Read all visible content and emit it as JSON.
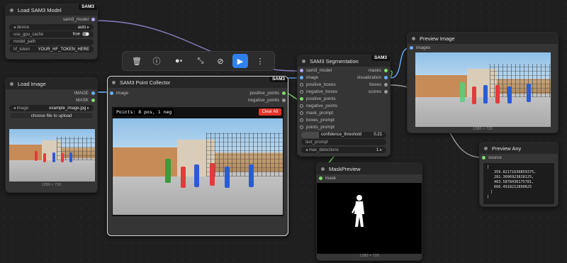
{
  "load_sam3": {
    "title": "Load SAM3 Model",
    "tag": "SAM3",
    "output": "sam3_model",
    "widgets": [
      {
        "label": "device",
        "value": "auto"
      },
      {
        "label": "use_gpu_cache",
        "value": "true"
      },
      {
        "label": "model_path",
        "value": ""
      },
      {
        "label": "hf_token",
        "value": "YOUR_HF_TOKEN_HERE"
      }
    ]
  },
  "load_image": {
    "title": "Load Image",
    "outputs": [
      "IMAGE",
      "MASK"
    ],
    "image_label": "image",
    "image_value": "example_image.jpg",
    "upload_button": "choose file to upload",
    "caption": "1280 × 720"
  },
  "point_collector": {
    "title": "SAM3 Point Collector",
    "tag": "SAM3",
    "input": "image",
    "outputs": [
      "positive_points",
      "negative_points"
    ],
    "points_status": "Points: 8 pos, 1 neg",
    "clear_button": "Clear All"
  },
  "segmentation": {
    "title": "SAM3 Segmentation",
    "tag": "SAM3",
    "inputs": [
      "sam3_model",
      "image",
      "positive_boxes",
      "negative_boxes",
      "positive_points",
      "negative_points",
      "mask_prompt",
      "boxes_prompt",
      "points_prompt"
    ],
    "outputs": [
      "masks",
      "visualization",
      "boxes",
      "scores"
    ],
    "confidence_label": "confidence_threshold",
    "confidence_value": "0.21",
    "text_prompt": "text_prompt",
    "max_detections_label": "max_detections",
    "max_detections_value": "1"
  },
  "preview_image": {
    "title": "Preview Image",
    "input": "images",
    "caption": "1280 × 720"
  },
  "preview_any": {
    "title": "Preview Any",
    "input": "source",
    "lines": [
      "[",
      "359.82171630859375,",
      "281.3096923828125,",
      "403.5878430175781,",
      "660.4918212890625",
      "]",
      "]"
    ]
  },
  "mask_preview": {
    "title": "MaskPreview",
    "input": "mask",
    "caption": "1280 × 720"
  },
  "colors": {
    "accent_blue": "#2f80ed",
    "clear_red": "#e0352b",
    "pin_green": "#7edc6e",
    "pin_blue": "#6ab0ff"
  }
}
